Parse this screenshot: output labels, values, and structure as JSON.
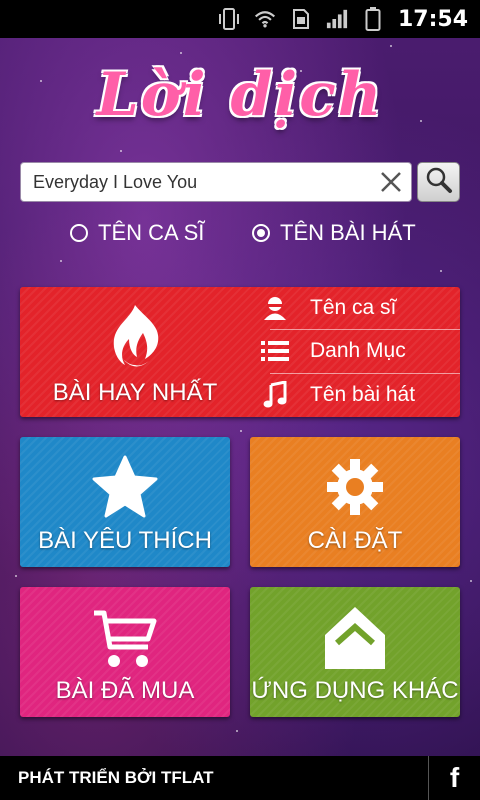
{
  "status_bar": {
    "time": "17:54",
    "icons": [
      "vibrate-icon",
      "wifi-icon",
      "sim-icon",
      "signal-icon",
      "battery-icon"
    ]
  },
  "app": {
    "logo_text": "Lời dịch",
    "logo_color": "#ff5fa8"
  },
  "search": {
    "value": "Everyday I Love You",
    "placeholder": ""
  },
  "radio": {
    "options": [
      {
        "label": "TÊN CA SĨ",
        "checked": false
      },
      {
        "label": "TÊN BÀI HÁT",
        "checked": true
      }
    ]
  },
  "tiles": {
    "top_songs": {
      "label": "BÀI HAY NHẤT",
      "color": "#e3232a",
      "icon": "flame-icon"
    },
    "menu": [
      {
        "label": "Tên ca sĩ",
        "icon": "person-icon"
      },
      {
        "label": "Danh Mục",
        "icon": "list-icon"
      },
      {
        "label": "Tên bài hát",
        "icon": "music-note-icon"
      }
    ],
    "favorites": {
      "label": "BÀI YÊU THÍCH",
      "color": "#1f88c8",
      "icon": "star-icon"
    },
    "settings": {
      "label": "CÀI ĐẶT",
      "color": "#e97f22",
      "icon": "gear-icon"
    },
    "purchased": {
      "label": "BÀI ĐÃ MUA",
      "color": "#e0257f",
      "icon": "cart-icon"
    },
    "other_apps": {
      "label": "ỨNG DỤNG KHÁC",
      "color": "#72a22b",
      "icon": "house-icon"
    }
  },
  "footer": {
    "developer": "PHÁT TRIỂN BỞI TFLAT",
    "facebook_label": "f"
  }
}
